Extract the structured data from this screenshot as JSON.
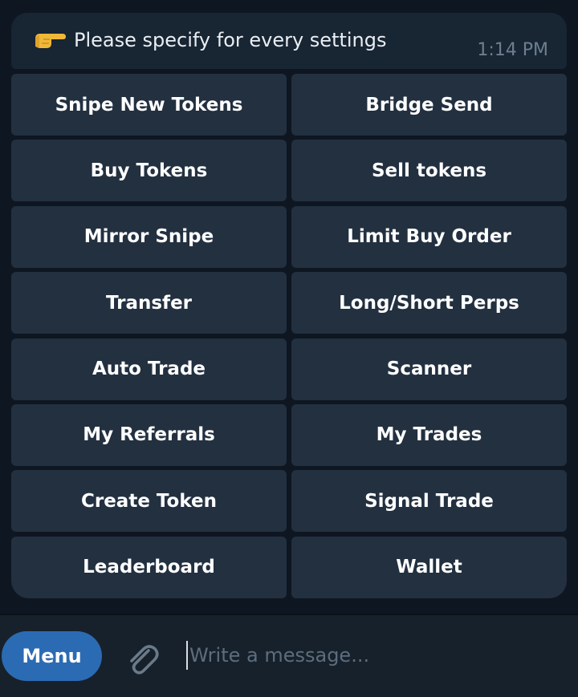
{
  "message": {
    "emoji": "backhand-index-pointing-right-emoji",
    "text": "Please specify for every settings",
    "time": "1:14 PM"
  },
  "keyboard": {
    "buttons": [
      [
        "Snipe New Tokens",
        "Bridge Send"
      ],
      [
        "Buy Tokens",
        "Sell tokens"
      ],
      [
        "Mirror Snipe",
        "Limit Buy Order"
      ],
      [
        "Transfer",
        "Long/Short Perps"
      ],
      [
        "Auto Trade",
        "Scanner"
      ],
      [
        "My Referrals",
        "My Trades"
      ],
      [
        "Create Token",
        "Signal Trade"
      ],
      [
        "Leaderboard",
        "Wallet"
      ]
    ]
  },
  "composer": {
    "menu_label": "Menu",
    "attach_icon": "paperclip-icon",
    "input_placeholder": "Write a message..."
  },
  "colors": {
    "background": "#0e1621",
    "bubble": "#182533",
    "button": "#223040",
    "menu_button": "#2b6bb3",
    "composer": "#17212b"
  }
}
